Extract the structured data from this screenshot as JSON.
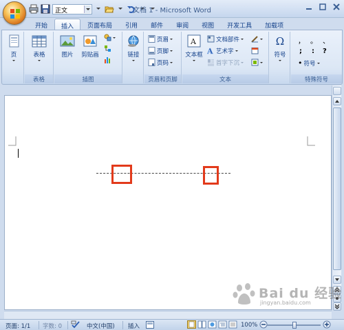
{
  "window": {
    "title": "文档 1 - Microsoft Word"
  },
  "quick_access": {
    "style_value": "正文"
  },
  "tabs": [
    {
      "label": "开始"
    },
    {
      "label": "插入"
    },
    {
      "label": "页面布局"
    },
    {
      "label": "引用"
    },
    {
      "label": "邮件"
    },
    {
      "label": "审阅"
    },
    {
      "label": "视图"
    },
    {
      "label": "开发工具"
    },
    {
      "label": "加载项"
    }
  ],
  "ribbon": {
    "pages": {
      "page_label": "页"
    },
    "tables": {
      "table_label": "表格",
      "group_label": "表格"
    },
    "illustrations": {
      "picture_label": "图片",
      "clipart_label": "剪贴画",
      "group_label": "插图"
    },
    "links": {
      "link_label": "链接"
    },
    "header_footer": {
      "header_label": "页眉",
      "footer_label": "页脚",
      "pagenum_label": "页码",
      "group_label": "页眉和页脚"
    },
    "text": {
      "textbox_label": "文本框",
      "quickparts_label": "文档部件",
      "wordart_label": "艺术字",
      "dropcap_label": "首字下沉",
      "group_label": "文本"
    },
    "symbols": {
      "symbol_label": "符号",
      "symbol_glyph": "Ω"
    },
    "special": {
      "row1": [
        "，",
        "。",
        "、"
      ],
      "row2": [
        ";",
        ":",
        "?"
      ],
      "bullet": "•",
      "symbol_label": "符号",
      "group_label": "特殊符号"
    }
  },
  "status": {
    "page": "页面: 1/1",
    "words": "字数: 0",
    "language": "中文(中国)",
    "mode": "插入",
    "zoom": "100%"
  },
  "watermark": {
    "text": "Bai du 经验",
    "url": "jingyan.baidu.com"
  },
  "colors": {
    "highlight": "#e23a1b"
  }
}
